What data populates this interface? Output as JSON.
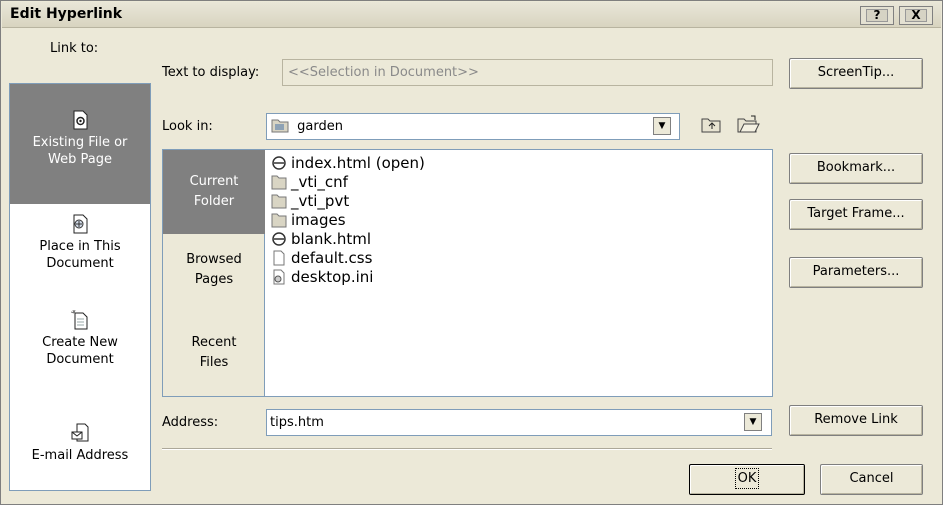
{
  "dialog": {
    "title": "Edit Hyperlink",
    "help_label": "?",
    "close_label": "X"
  },
  "link_to": {
    "label": "Link to:",
    "items": [
      {
        "line1": "Existing File or",
        "line2": "Web Page",
        "icon": "existing-file-icon",
        "selected": true
      },
      {
        "line1": "Place in This",
        "line2": "Document",
        "icon": "place-in-document-icon",
        "selected": false
      },
      {
        "line1": "Create New",
        "line2": "Document",
        "icon": "new-document-icon",
        "selected": false
      },
      {
        "line1": "E-mail Address",
        "line2": "",
        "icon": "email-icon",
        "selected": false
      }
    ]
  },
  "text_to_display": {
    "label": "Text to display:",
    "value": "<<Selection in Document>>"
  },
  "look_in": {
    "label": "Look in:",
    "value": "garden",
    "icon": "folder-icon"
  },
  "nav": [
    {
      "line1": "Current",
      "line2": "Folder",
      "selected": true
    },
    {
      "line1": "Browsed",
      "line2": "Pages",
      "selected": false
    },
    {
      "line1": "Recent",
      "line2": "Files",
      "selected": false
    }
  ],
  "files": [
    {
      "name": "index.html (open)",
      "icon": "html-file-icon"
    },
    {
      "name": "_vti_cnf",
      "icon": "folder-icon"
    },
    {
      "name": "_vti_pvt",
      "icon": "folder-icon"
    },
    {
      "name": "images",
      "icon": "folder-icon"
    },
    {
      "name": "blank.html",
      "icon": "html-file-icon"
    },
    {
      "name": "default.css",
      "icon": "css-file-icon"
    },
    {
      "name": "desktop.ini",
      "icon": "ini-file-icon"
    }
  ],
  "address": {
    "label": "Address:",
    "value": "tips.htm"
  },
  "buttons": {
    "screentip": "ScreenTip...",
    "bookmark": "Bookmark...",
    "target_frame": "Target Frame...",
    "parameters": "Parameters...",
    "remove_link": "Remove Link",
    "ok": "OK",
    "cancel": "Cancel"
  },
  "colors": {
    "dialog_bg": "#ece9d8",
    "selected_bg": "#808080",
    "field_border": "#7f9db9"
  }
}
